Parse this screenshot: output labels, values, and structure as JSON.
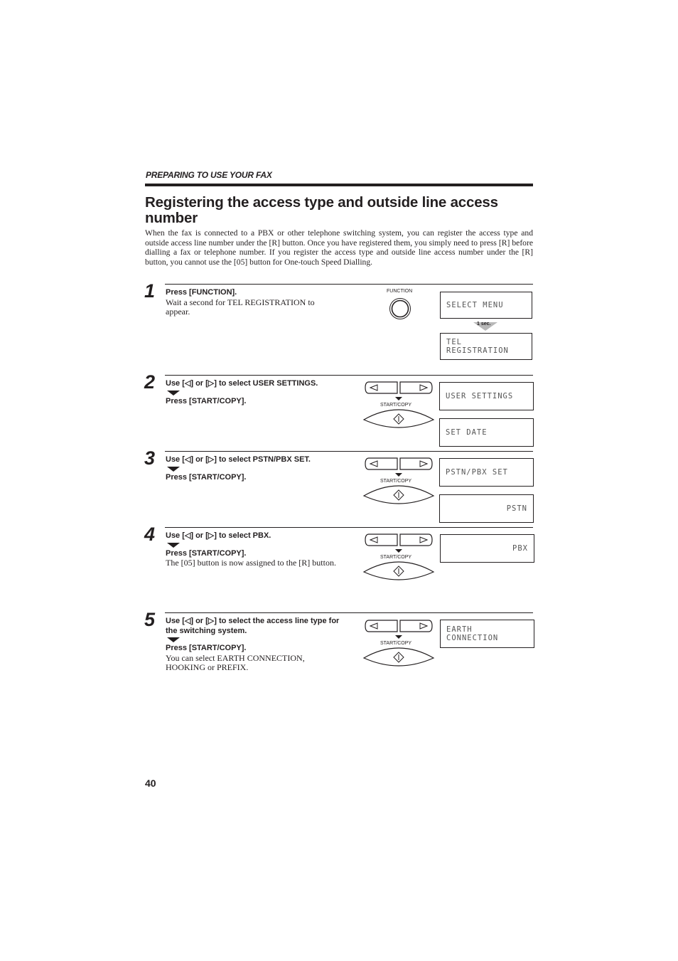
{
  "header": {
    "section": "PREPARING TO USE YOUR FAX"
  },
  "title": "Registering the access type and outside line access number",
  "intro": "When the fax is connected to a PBX or other telephone switching system, you can register the access type and outside access line number under the [R] button. Once you have registered them, you simply need to press [R] before dialling a fax or telephone number. If you register the access type and outside line access number under the [R] button, you cannot use the [05] button for One-touch Speed Dialling.",
  "panel_labels": {
    "function": "FUNCTION",
    "start_copy": "START/COPY",
    "delay": "1 sec."
  },
  "icons": {
    "function_button": "function-button-icon",
    "arrow_keys": "left-right-arrow-keys-icon",
    "start_copy_button": "start-copy-button-icon",
    "next_arrow": "down-triangle-arrow-icon"
  },
  "steps": [
    {
      "number": "1",
      "instruction": "Press [FUNCTION].",
      "note": "Wait a second for TEL REGISTRATION to appear.",
      "displays": [
        "SELECT MENU",
        "TEL REGISTRATION"
      ]
    },
    {
      "number": "2",
      "instruction": "Use [◁] or [▷] to select USER SETTINGS.",
      "action": "Press [START/COPY].",
      "displays": [
        "USER SETTINGS",
        "SET DATE"
      ]
    },
    {
      "number": "3",
      "instruction": "Use [◁] or [▷] to select PSTN/PBX SET.",
      "action": "Press [START/COPY].",
      "displays": [
        "PSTN/PBX SET",
        "PSTN"
      ]
    },
    {
      "number": "4",
      "instruction": "Use [◁] or [▷] to select PBX.",
      "action": "Press [START/COPY].",
      "note": "The [05] button is now assigned to the [R] button.",
      "displays": [
        "PBX"
      ]
    },
    {
      "number": "5",
      "instruction": "Use [◁] or [▷] to select the access line type for the switching system.",
      "action": "Press [START/COPY].",
      "note": "You can select EARTH CONNECTION, HOOKING or PREFIX.",
      "displays": [
        "EARTH CONNECTION"
      ]
    }
  ],
  "footer": {
    "page_number": "40"
  }
}
